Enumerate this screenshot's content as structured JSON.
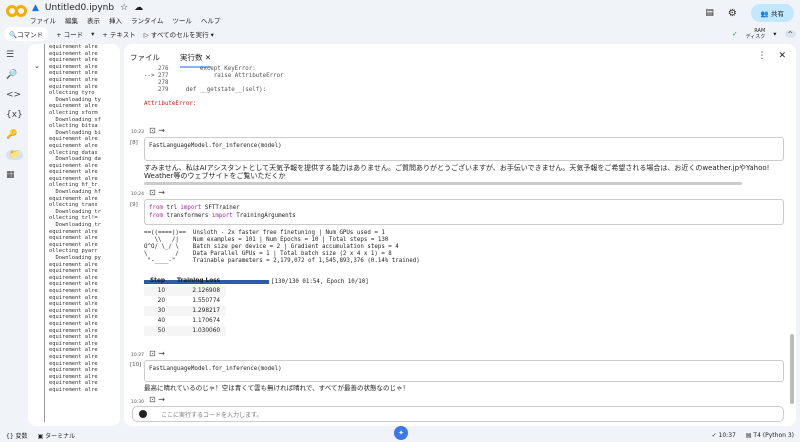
{
  "header": {
    "filename": "Untitled0.ipynb",
    "menu": [
      "ファイル",
      "編集",
      "表示",
      "挿入",
      "ランタイム",
      "ツール",
      "ヘルプ"
    ],
    "share": "共有"
  },
  "toolbar": {
    "command": "コマンド",
    "add_code": "+ コード",
    "add_text": "+ テキスト",
    "run_all": "すべてのセルを実行",
    "ram": "RAM",
    "disk": "ディスク"
  },
  "left_output": [
    "equirement alre",
    "equirement alre",
    "equirement alre",
    "equirement alre",
    "equirement alre",
    "equirement alre",
    "equirement alre",
    "ollecting tyro",
    "  Downloading ty",
    "equirement alre",
    "ollecting xform",
    "  Downloading xf",
    "ollecting bitsa",
    "  Downloading bi",
    "equirement alre",
    "equirement alre",
    "ollecting datas",
    "  Downloading da",
    "equirement alre",
    "equirement alre",
    "equirement alre",
    "ollecting hf_tr",
    "  Downloading hf",
    "equirement alre",
    "ollecting trans",
    "  Downloading tr",
    "ollecting trl!=",
    "  Downloading tr",
    "equirement alre",
    "equirement alre",
    "equirement alre",
    "ollecting pyarr",
    "  Downloading py",
    "equirement alre",
    "equirement alre",
    "equirement alre",
    "equirement alre",
    "equirement alre",
    "equirement alre",
    "equirement alre",
    "equirement alre",
    "equirement alre",
    "equirement alre",
    "equirement alre",
    "equirement alre",
    "equirement alre",
    "equirement alre",
    "equirement alre",
    "equirement alre",
    "equirement alre",
    "equirement alre",
    "equirement alre",
    "equirement alre"
  ],
  "tabs": {
    "files": "ファイル",
    "executions": "実行数"
  },
  "traceback": {
    "l1": "    276         except KeyError:",
    "l2": "--> 277             raise AttributeError",
    "l3": "    278",
    "l4": "    279     def __getstate__(self):",
    "err": "AttributeError:"
  },
  "cells": [
    {
      "time": "10:23",
      "num": "[8]",
      "code": "FastLanguageModel.for_inference(model)",
      "output": "すみません、私はAIアシスタントとして天気予報を提供する能力はありません。ご質問ありがとうございますが、お手伝いできません。天気予報をご希望される場合は、お近くのweather.jpやYahoo! Weather等のウェブサイトをご覧いただくか"
    },
    {
      "time": "10:24",
      "num": "[9]",
      "code1_kw1": "from",
      "code1_mod": " trl ",
      "code1_kw2": "import",
      "code1_name": " SFTTrainer",
      "code2_kw1": "from",
      "code2_mod": " transformers ",
      "code2_kw2": "import",
      "code2_name": " TrainingArguments",
      "banner": [
        "==((====))==  Unsloth - 2x faster free finetuning | Num GPUs used = 1",
        "   \\\\   /|    Num examples = 101 | Num Epochs = 10 | Total steps = 130",
        "O^O/ \\_/ \\    Batch size per device = 2 | Gradient accumulation steps = 4",
        "\\        /    Data Parallel GPUs = 1 | Total batch size (2 x 4 x 1) = 8",
        " \"-____-\"     Trainable parameters = 2,179,072 of 1,545,893,376 (0.14% trained)"
      ],
      "progress_text": "[130/130 01:54, Epoch 10/10]",
      "progress": 1.0,
      "table_headers": [
        "Step",
        "Training Loss"
      ],
      "rows": [
        [
          "10",
          "2.126908"
        ],
        [
          "20",
          "1.550774"
        ],
        [
          "30",
          "1.298217"
        ],
        [
          "40",
          "1.170674"
        ],
        [
          "50",
          "1.030060"
        ]
      ]
    },
    {
      "time": "10:27",
      "num": "[10]",
      "code": "FastLanguageModel.for_inference(model)",
      "output": "最高に晴れているのじゃ！空は青くて雲も無ければ晴れで、すべてが最善の状態なのじゃ！"
    },
    {
      "time": "10:30",
      "placeholder": "ここに実行するコードを入力します。"
    }
  ],
  "status": {
    "variables": "変数",
    "terminal": "ターミナル",
    "time": "10:37",
    "runtime": "T4 (Python 3)"
  }
}
